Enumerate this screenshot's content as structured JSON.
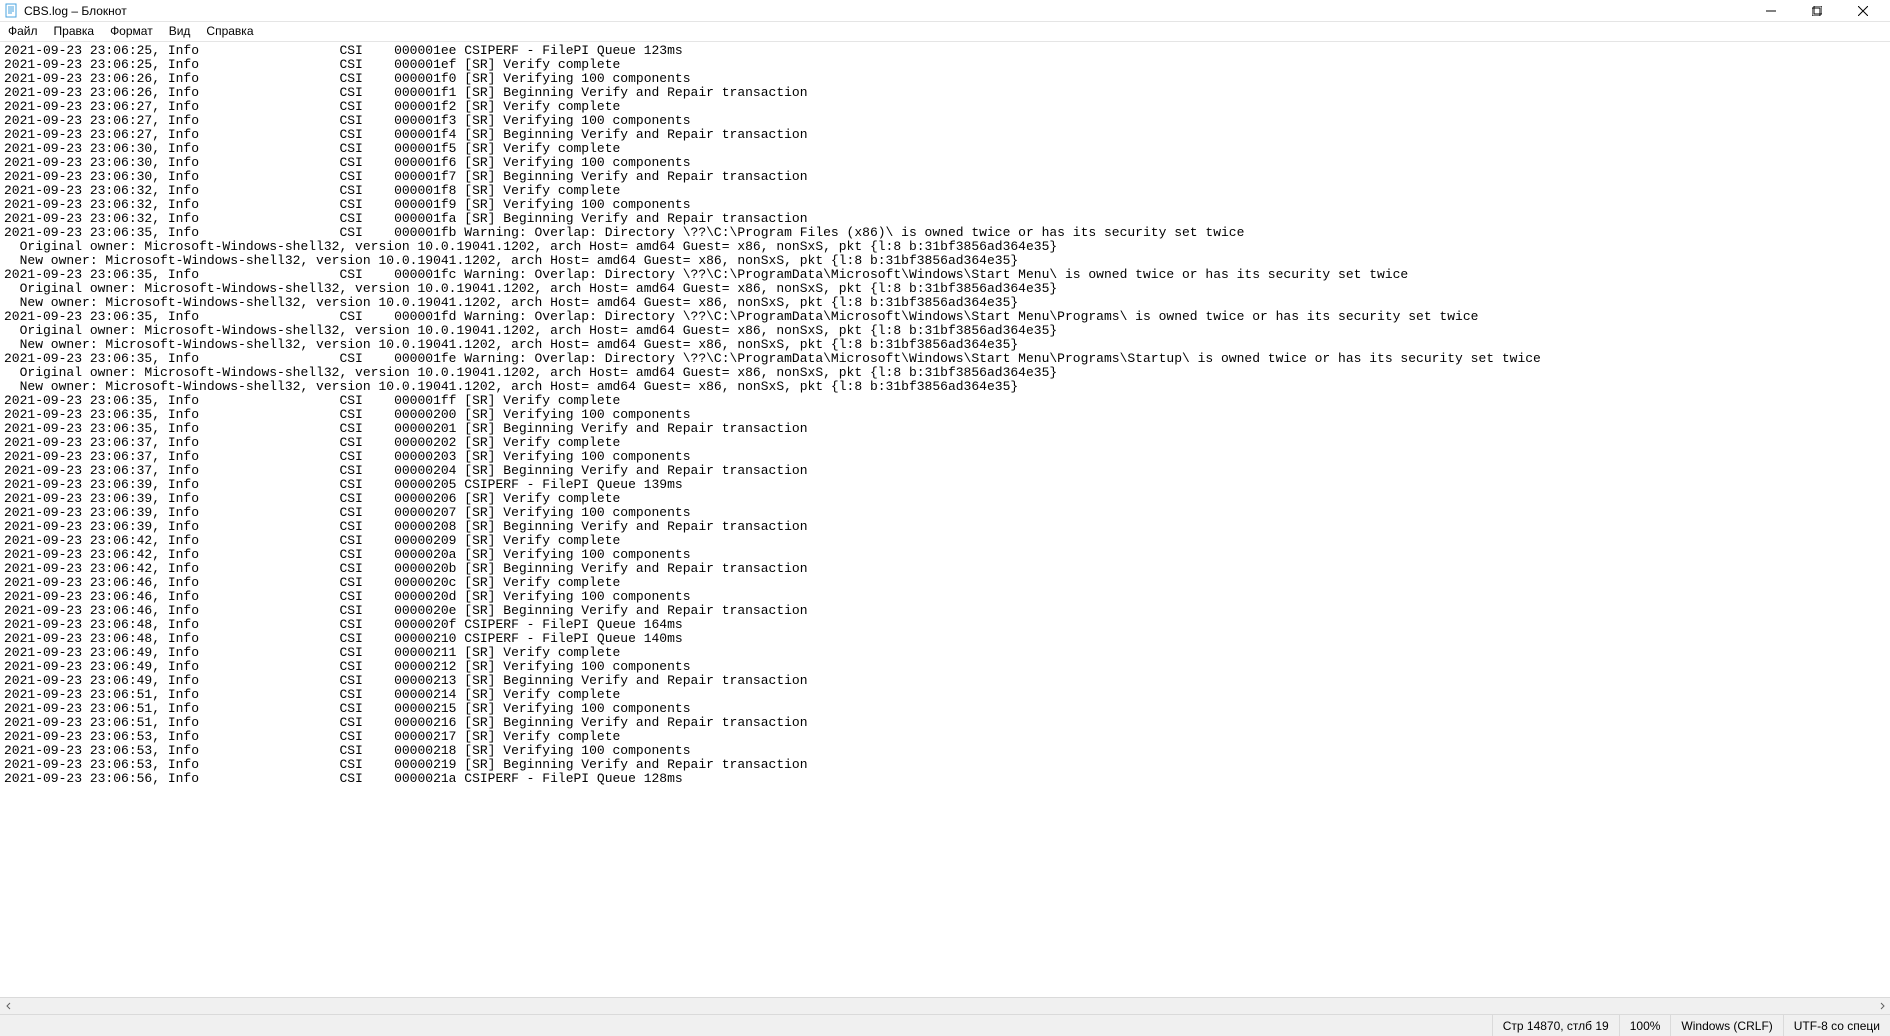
{
  "window": {
    "title": "CBS.log – Блокнот"
  },
  "menu": {
    "file": "Файл",
    "edit": "Правка",
    "format": "Формат",
    "view": "Вид",
    "help": "Справка"
  },
  "status": {
    "position": "Стр 14870, стлб 19",
    "zoom": "100%",
    "line_ending": "Windows (CRLF)",
    "encoding": "UTF-8 со специ"
  },
  "log_lines": [
    "2021-09-23 23:06:25, Info                  CSI    000001ee CSIPERF - FilePI Queue 123ms",
    "2021-09-23 23:06:25, Info                  CSI    000001ef [SR] Verify complete",
    "2021-09-23 23:06:26, Info                  CSI    000001f0 [SR] Verifying 100 components",
    "2021-09-23 23:06:26, Info                  CSI    000001f1 [SR] Beginning Verify and Repair transaction",
    "2021-09-23 23:06:27, Info                  CSI    000001f2 [SR] Verify complete",
    "2021-09-23 23:06:27, Info                  CSI    000001f3 [SR] Verifying 100 components",
    "2021-09-23 23:06:27, Info                  CSI    000001f4 [SR] Beginning Verify and Repair transaction",
    "2021-09-23 23:06:30, Info                  CSI    000001f5 [SR] Verify complete",
    "2021-09-23 23:06:30, Info                  CSI    000001f6 [SR] Verifying 100 components",
    "2021-09-23 23:06:30, Info                  CSI    000001f7 [SR] Beginning Verify and Repair transaction",
    "2021-09-23 23:06:32, Info                  CSI    000001f8 [SR] Verify complete",
    "2021-09-23 23:06:32, Info                  CSI    000001f9 [SR] Verifying 100 components",
    "2021-09-23 23:06:32, Info                  CSI    000001fa [SR] Beginning Verify and Repair transaction",
    "2021-09-23 23:06:35, Info                  CSI    000001fb Warning: Overlap: Directory \\??\\C:\\Program Files (x86)\\ is owned twice or has its security set twice",
    "  Original owner: Microsoft-Windows-shell32, version 10.0.19041.1202, arch Host= amd64 Guest= x86, nonSxS, pkt {l:8 b:31bf3856ad364e35}",
    "  New owner: Microsoft-Windows-shell32, version 10.0.19041.1202, arch Host= amd64 Guest= x86, nonSxS, pkt {l:8 b:31bf3856ad364e35}",
    "2021-09-23 23:06:35, Info                  CSI    000001fc Warning: Overlap: Directory \\??\\C:\\ProgramData\\Microsoft\\Windows\\Start Menu\\ is owned twice or has its security set twice",
    "  Original owner: Microsoft-Windows-shell32, version 10.0.19041.1202, arch Host= amd64 Guest= x86, nonSxS, pkt {l:8 b:31bf3856ad364e35}",
    "  New owner: Microsoft-Windows-shell32, version 10.0.19041.1202, arch Host= amd64 Guest= x86, nonSxS, pkt {l:8 b:31bf3856ad364e35}",
    "2021-09-23 23:06:35, Info                  CSI    000001fd Warning: Overlap: Directory \\??\\C:\\ProgramData\\Microsoft\\Windows\\Start Menu\\Programs\\ is owned twice or has its security set twice",
    "  Original owner: Microsoft-Windows-shell32, version 10.0.19041.1202, arch Host= amd64 Guest= x86, nonSxS, pkt {l:8 b:31bf3856ad364e35}",
    "  New owner: Microsoft-Windows-shell32, version 10.0.19041.1202, arch Host= amd64 Guest= x86, nonSxS, pkt {l:8 b:31bf3856ad364e35}",
    "2021-09-23 23:06:35, Info                  CSI    000001fe Warning: Overlap: Directory \\??\\C:\\ProgramData\\Microsoft\\Windows\\Start Menu\\Programs\\Startup\\ is owned twice or has its security set twice",
    "  Original owner: Microsoft-Windows-shell32, version 10.0.19041.1202, arch Host= amd64 Guest= x86, nonSxS, pkt {l:8 b:31bf3856ad364e35}",
    "  New owner: Microsoft-Windows-shell32, version 10.0.19041.1202, arch Host= amd64 Guest= x86, nonSxS, pkt {l:8 b:31bf3856ad364e35}",
    "2021-09-23 23:06:35, Info                  CSI    000001ff [SR] Verify complete",
    "2021-09-23 23:06:35, Info                  CSI    00000200 [SR] Verifying 100 components",
    "2021-09-23 23:06:35, Info                  CSI    00000201 [SR] Beginning Verify and Repair transaction",
    "2021-09-23 23:06:37, Info                  CSI    00000202 [SR] Verify complete",
    "2021-09-23 23:06:37, Info                  CSI    00000203 [SR] Verifying 100 components",
    "2021-09-23 23:06:37, Info                  CSI    00000204 [SR] Beginning Verify and Repair transaction",
    "2021-09-23 23:06:39, Info                  CSI    00000205 CSIPERF - FilePI Queue 139ms",
    "2021-09-23 23:06:39, Info                  CSI    00000206 [SR] Verify complete",
    "2021-09-23 23:06:39, Info                  CSI    00000207 [SR] Verifying 100 components",
    "2021-09-23 23:06:39, Info                  CSI    00000208 [SR] Beginning Verify and Repair transaction",
    "2021-09-23 23:06:42, Info                  CSI    00000209 [SR] Verify complete",
    "2021-09-23 23:06:42, Info                  CSI    0000020a [SR] Verifying 100 components",
    "2021-09-23 23:06:42, Info                  CSI    0000020b [SR] Beginning Verify and Repair transaction",
    "2021-09-23 23:06:46, Info                  CSI    0000020c [SR] Verify complete",
    "2021-09-23 23:06:46, Info                  CSI    0000020d [SR] Verifying 100 components",
    "2021-09-23 23:06:46, Info                  CSI    0000020e [SR] Beginning Verify and Repair transaction",
    "2021-09-23 23:06:48, Info                  CSI    0000020f CSIPERF - FilePI Queue 164ms",
    "2021-09-23 23:06:48, Info                  CSI    00000210 CSIPERF - FilePI Queue 140ms",
    "2021-09-23 23:06:49, Info                  CSI    00000211 [SR] Verify complete",
    "2021-09-23 23:06:49, Info                  CSI    00000212 [SR] Verifying 100 components",
    "2021-09-23 23:06:49, Info                  CSI    00000213 [SR] Beginning Verify and Repair transaction",
    "2021-09-23 23:06:51, Info                  CSI    00000214 [SR] Verify complete",
    "2021-09-23 23:06:51, Info                  CSI    00000215 [SR] Verifying 100 components",
    "2021-09-23 23:06:51, Info                  CSI    00000216 [SR] Beginning Verify and Repair transaction",
    "2021-09-23 23:06:53, Info                  CSI    00000217 [SR] Verify complete",
    "2021-09-23 23:06:53, Info                  CSI    00000218 [SR] Verifying 100 components",
    "2021-09-23 23:06:53, Info                  CSI    00000219 [SR] Beginning Verify and Repair transaction",
    "2021-09-23 23:06:56, Info                  CSI    0000021a CSIPERF - FilePI Queue 128ms"
  ]
}
